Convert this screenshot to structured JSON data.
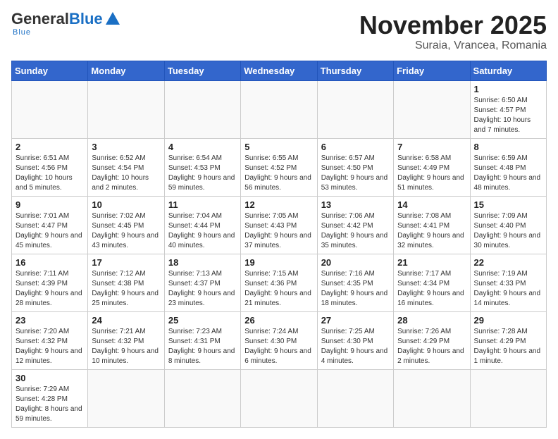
{
  "header": {
    "logo_general": "General",
    "logo_blue": "Blue",
    "logo_sub": "Blue",
    "month_title": "November 2025",
    "location": "Suraia, Vrancea, Romania"
  },
  "weekdays": [
    "Sunday",
    "Monday",
    "Tuesday",
    "Wednesday",
    "Thursday",
    "Friday",
    "Saturday"
  ],
  "weeks": [
    [
      {
        "day": "",
        "info": ""
      },
      {
        "day": "",
        "info": ""
      },
      {
        "day": "",
        "info": ""
      },
      {
        "day": "",
        "info": ""
      },
      {
        "day": "",
        "info": ""
      },
      {
        "day": "",
        "info": ""
      },
      {
        "day": "1",
        "info": "Sunrise: 6:50 AM\nSunset: 4:57 PM\nDaylight: 10 hours and 7 minutes."
      }
    ],
    [
      {
        "day": "2",
        "info": "Sunrise: 6:51 AM\nSunset: 4:56 PM\nDaylight: 10 hours and 5 minutes."
      },
      {
        "day": "3",
        "info": "Sunrise: 6:52 AM\nSunset: 4:54 PM\nDaylight: 10 hours and 2 minutes."
      },
      {
        "day": "4",
        "info": "Sunrise: 6:54 AM\nSunset: 4:53 PM\nDaylight: 9 hours and 59 minutes."
      },
      {
        "day": "5",
        "info": "Sunrise: 6:55 AM\nSunset: 4:52 PM\nDaylight: 9 hours and 56 minutes."
      },
      {
        "day": "6",
        "info": "Sunrise: 6:57 AM\nSunset: 4:50 PM\nDaylight: 9 hours and 53 minutes."
      },
      {
        "day": "7",
        "info": "Sunrise: 6:58 AM\nSunset: 4:49 PM\nDaylight: 9 hours and 51 minutes."
      },
      {
        "day": "8",
        "info": "Sunrise: 6:59 AM\nSunset: 4:48 PM\nDaylight: 9 hours and 48 minutes."
      }
    ],
    [
      {
        "day": "9",
        "info": "Sunrise: 7:01 AM\nSunset: 4:47 PM\nDaylight: 9 hours and 45 minutes."
      },
      {
        "day": "10",
        "info": "Sunrise: 7:02 AM\nSunset: 4:45 PM\nDaylight: 9 hours and 43 minutes."
      },
      {
        "day": "11",
        "info": "Sunrise: 7:04 AM\nSunset: 4:44 PM\nDaylight: 9 hours and 40 minutes."
      },
      {
        "day": "12",
        "info": "Sunrise: 7:05 AM\nSunset: 4:43 PM\nDaylight: 9 hours and 37 minutes."
      },
      {
        "day": "13",
        "info": "Sunrise: 7:06 AM\nSunset: 4:42 PM\nDaylight: 9 hours and 35 minutes."
      },
      {
        "day": "14",
        "info": "Sunrise: 7:08 AM\nSunset: 4:41 PM\nDaylight: 9 hours and 32 minutes."
      },
      {
        "day": "15",
        "info": "Sunrise: 7:09 AM\nSunset: 4:40 PM\nDaylight: 9 hours and 30 minutes."
      }
    ],
    [
      {
        "day": "16",
        "info": "Sunrise: 7:11 AM\nSunset: 4:39 PM\nDaylight: 9 hours and 28 minutes."
      },
      {
        "day": "17",
        "info": "Sunrise: 7:12 AM\nSunset: 4:38 PM\nDaylight: 9 hours and 25 minutes."
      },
      {
        "day": "18",
        "info": "Sunrise: 7:13 AM\nSunset: 4:37 PM\nDaylight: 9 hours and 23 minutes."
      },
      {
        "day": "19",
        "info": "Sunrise: 7:15 AM\nSunset: 4:36 PM\nDaylight: 9 hours and 21 minutes."
      },
      {
        "day": "20",
        "info": "Sunrise: 7:16 AM\nSunset: 4:35 PM\nDaylight: 9 hours and 18 minutes."
      },
      {
        "day": "21",
        "info": "Sunrise: 7:17 AM\nSunset: 4:34 PM\nDaylight: 9 hours and 16 minutes."
      },
      {
        "day": "22",
        "info": "Sunrise: 7:19 AM\nSunset: 4:33 PM\nDaylight: 9 hours and 14 minutes."
      }
    ],
    [
      {
        "day": "23",
        "info": "Sunrise: 7:20 AM\nSunset: 4:32 PM\nDaylight: 9 hours and 12 minutes."
      },
      {
        "day": "24",
        "info": "Sunrise: 7:21 AM\nSunset: 4:32 PM\nDaylight: 9 hours and 10 minutes."
      },
      {
        "day": "25",
        "info": "Sunrise: 7:23 AM\nSunset: 4:31 PM\nDaylight: 9 hours and 8 minutes."
      },
      {
        "day": "26",
        "info": "Sunrise: 7:24 AM\nSunset: 4:30 PM\nDaylight: 9 hours and 6 minutes."
      },
      {
        "day": "27",
        "info": "Sunrise: 7:25 AM\nSunset: 4:30 PM\nDaylight: 9 hours and 4 minutes."
      },
      {
        "day": "28",
        "info": "Sunrise: 7:26 AM\nSunset: 4:29 PM\nDaylight: 9 hours and 2 minutes."
      },
      {
        "day": "29",
        "info": "Sunrise: 7:28 AM\nSunset: 4:29 PM\nDaylight: 9 hours and 1 minute."
      }
    ],
    [
      {
        "day": "30",
        "info": "Sunrise: 7:29 AM\nSunset: 4:28 PM\nDaylight: 8 hours and 59 minutes."
      },
      {
        "day": "",
        "info": ""
      },
      {
        "day": "",
        "info": ""
      },
      {
        "day": "",
        "info": ""
      },
      {
        "day": "",
        "info": ""
      },
      {
        "day": "",
        "info": ""
      },
      {
        "day": "",
        "info": ""
      }
    ]
  ]
}
